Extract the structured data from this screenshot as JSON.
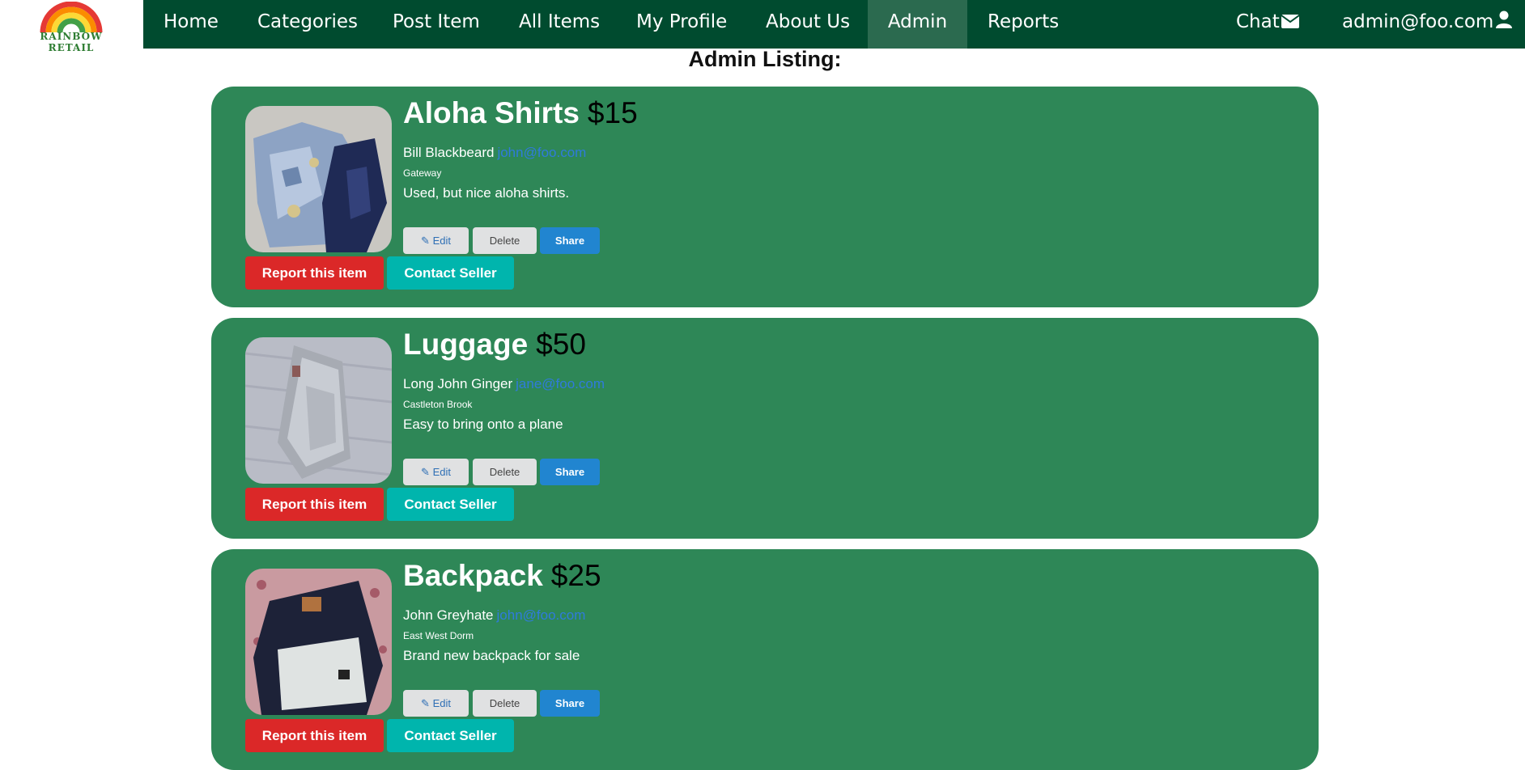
{
  "brand": {
    "logo_text": "RAINBOW RETAIL"
  },
  "nav": {
    "items": [
      {
        "label": "Home"
      },
      {
        "label": "Categories"
      },
      {
        "label": "Post Item"
      },
      {
        "label": "All Items"
      },
      {
        "label": "My Profile"
      },
      {
        "label": "About Us"
      },
      {
        "label": "Admin",
        "active": true
      },
      {
        "label": "Reports"
      }
    ],
    "chat_label": "Chat",
    "user_label": "admin@foo.com"
  },
  "page": {
    "title": "Admin Listing:"
  },
  "colors": {
    "nav_bg": "#004b2f",
    "card_bg": "#2e8757",
    "report": "#db2828",
    "contact": "#00b5ad",
    "share": "#2185d0"
  },
  "listing": {
    "items": [
      {
        "name": "Aloha Shirts",
        "price": "$15",
        "seller": "Bill Blackbeard",
        "email": "john@foo.com",
        "location": "Gateway",
        "description": "Used, but nice aloha shirts.",
        "edit_label": "Edit",
        "delete_label": "Delete",
        "share_label": "Share",
        "report_label": "Report this item",
        "contact_label": "Contact Seller"
      },
      {
        "name": "Luggage",
        "price": "$50",
        "seller": "Long John Ginger",
        "email": "jane@foo.com",
        "location": "Castleton Brook",
        "description": "Easy to bring onto a plane",
        "edit_label": "Edit",
        "delete_label": "Delete",
        "share_label": "Share",
        "report_label": "Report this item",
        "contact_label": "Contact Seller"
      },
      {
        "name": "Backpack",
        "price": "$25",
        "seller": "John Greyhate",
        "email": "john@foo.com",
        "location": "East West Dorm",
        "description": "Brand new backpack for sale",
        "edit_label": "Edit",
        "delete_label": "Delete",
        "share_label": "Share",
        "report_label": "Report this item",
        "contact_label": "Contact Seller"
      }
    ]
  }
}
